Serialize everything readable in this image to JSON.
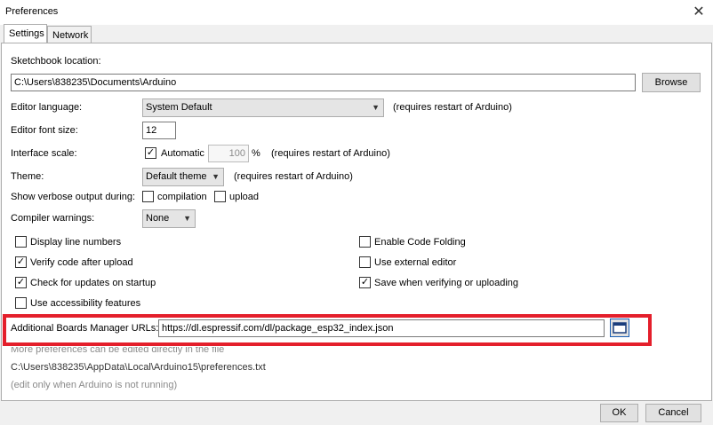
{
  "window": {
    "title": "Preferences",
    "close_glyph": "✕"
  },
  "tabs": [
    {
      "label": "Settings"
    },
    {
      "label": "Network"
    }
  ],
  "sketchbook": {
    "label": "Sketchbook location:",
    "value": "C:\\Users\\838235\\Documents\\Arduino",
    "browse_label": "Browse"
  },
  "editor_language": {
    "label": "Editor language:",
    "value": "System Default",
    "note": "(requires restart of Arduino)"
  },
  "editor_font_size": {
    "label": "Editor font size:",
    "value": "12"
  },
  "interface_scale": {
    "label": "Interface scale:",
    "automatic_label": "Automatic",
    "automatic_checked": true,
    "value": "100",
    "unit": "%",
    "note": "(requires restart of Arduino)"
  },
  "theme": {
    "label": "Theme:",
    "value": "Default theme",
    "note": "(requires restart of Arduino)"
  },
  "verbose": {
    "label": "Show verbose output during:",
    "compilation_label": "compilation",
    "compilation_checked": false,
    "upload_label": "upload",
    "upload_checked": false
  },
  "compiler_warnings": {
    "label": "Compiler warnings:",
    "value": "None"
  },
  "options_left": [
    {
      "label": "Display line numbers",
      "checked": false
    },
    {
      "label": "Verify code after upload",
      "checked": true
    },
    {
      "label": "Check for updates on startup",
      "checked": true
    },
    {
      "label": "Use accessibility features",
      "checked": false
    }
  ],
  "options_right": [
    {
      "label": "Enable Code Folding",
      "checked": false
    },
    {
      "label": "Use external editor",
      "checked": false
    },
    {
      "label": "Save when verifying or uploading",
      "checked": true
    }
  ],
  "boards_manager": {
    "label": "Additional Boards Manager URLs:",
    "value": "https://dl.espressif.com/dl/package_esp32_index.json"
  },
  "footer_notes": {
    "more_prefs": "More preferences can be edited directly in the file",
    "prefs_path": "C:\\Users\\838235\\AppData\\Local\\Arduino15\\preferences.txt",
    "edit_note": "(edit only when Arduino is not running)"
  },
  "buttons": {
    "ok": "OK",
    "cancel": "Cancel"
  },
  "colors": {
    "highlight": "#e41f2b"
  }
}
